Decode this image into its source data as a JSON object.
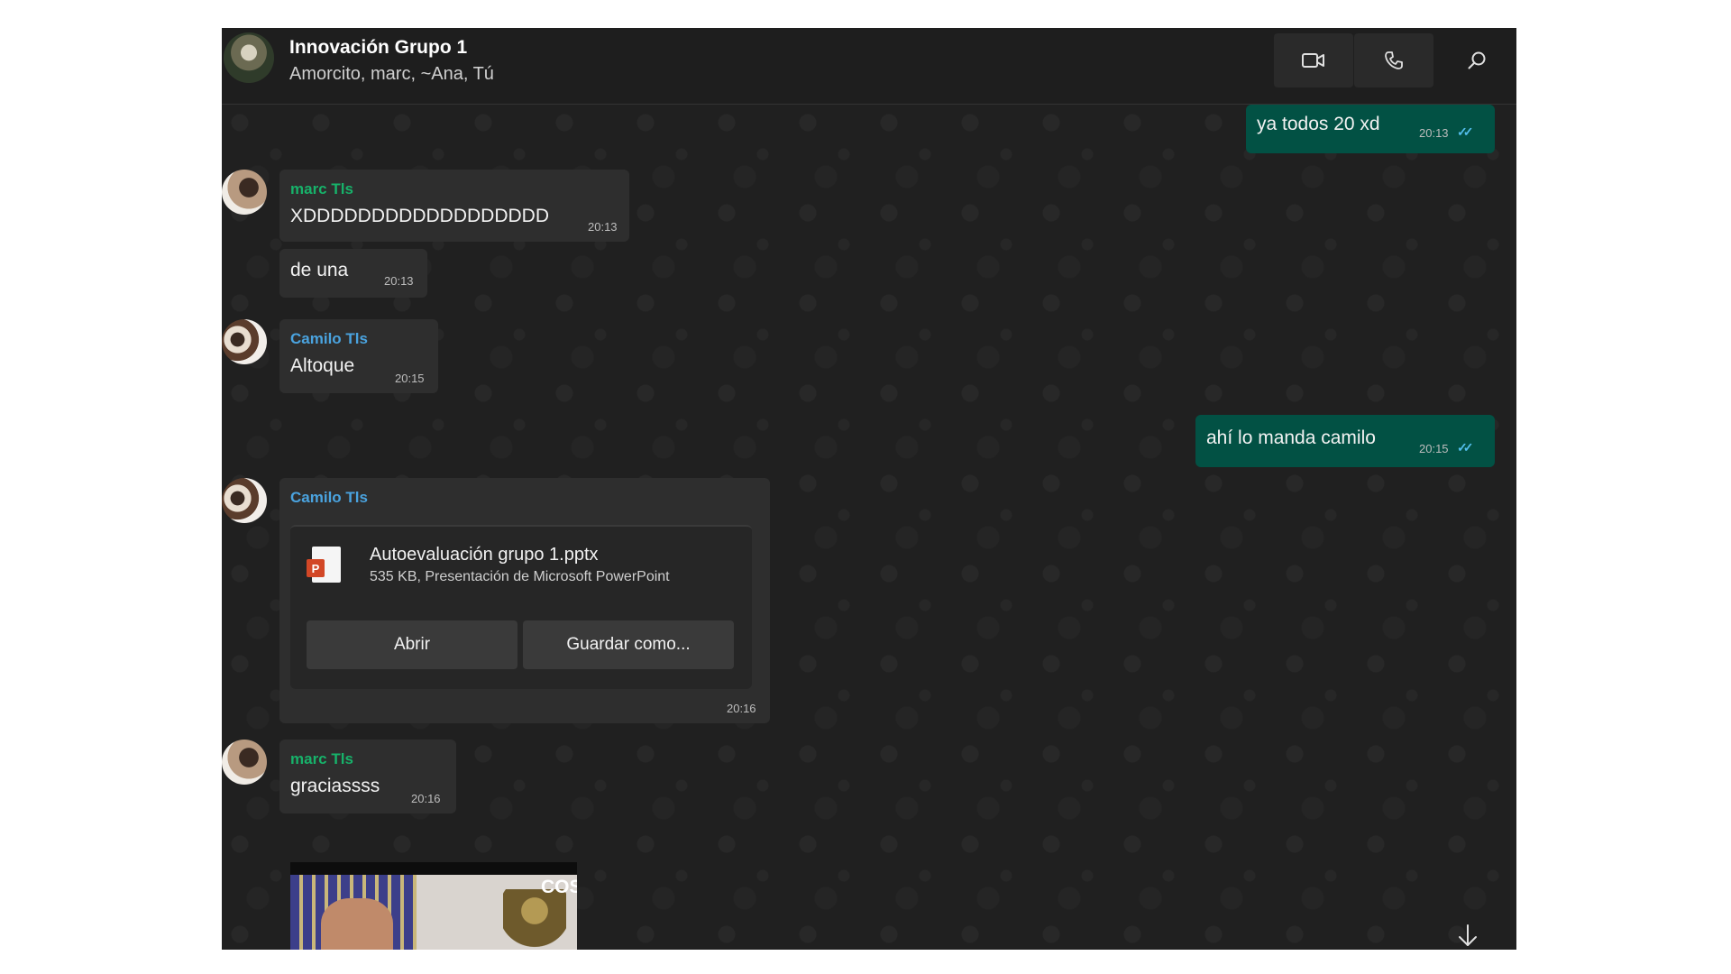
{
  "header": {
    "title": "Innovación Grupo 1",
    "members": "Amorcito, marc, ~Ana, Tú",
    "icons": [
      "video-call-icon",
      "phone-call-icon",
      "search-icon"
    ]
  },
  "messages": [
    {
      "type": "outgoing",
      "text": "ya todos 20 xd",
      "time": "20:13",
      "status": "read"
    },
    {
      "type": "incoming",
      "sender": "marc Tls",
      "text": "XDDDDDDDDDDDDDDDDDD",
      "time": "20:13"
    },
    {
      "type": "incoming",
      "text": "de una",
      "time": "20:13"
    },
    {
      "type": "incoming",
      "sender": "Camilo Tls",
      "text": "Altoque",
      "time": "20:15"
    },
    {
      "type": "outgoing",
      "text": "ahí lo manda camilo",
      "time": "20:15",
      "status": "read"
    },
    {
      "type": "incoming-file",
      "sender": "Camilo Tls",
      "file": {
        "name": "Autoevaluación grupo 1.pptx",
        "meta": "535 KB, Presentación de Microsoft PowerPoint",
        "icon": "powerpoint-file-icon",
        "icon_badge": "P"
      },
      "buttons": {
        "open": "Abrir",
        "save_as": "Guardar como..."
      },
      "time": "20:16"
    },
    {
      "type": "incoming",
      "sender": "marc Tls",
      "text": "graciassss",
      "time": "20:16"
    },
    {
      "type": "incoming-image",
      "overlay_text": "COS"
    }
  ],
  "colors": {
    "outgoing_bubble": "#025144",
    "incoming_bubble": "#2e2e2e",
    "sender_marc": "#17b26a",
    "sender_camilo": "#4aa3df",
    "read_ticks": "#53bdeb"
  }
}
